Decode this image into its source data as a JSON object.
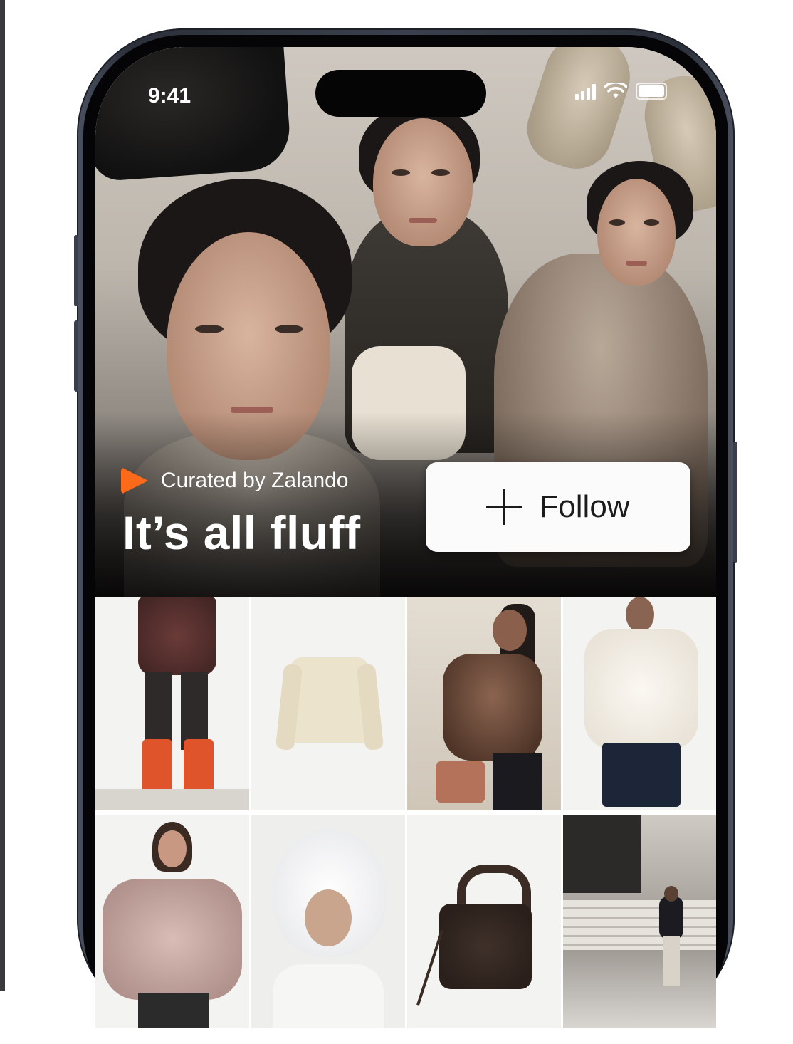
{
  "status_bar": {
    "time": "9:41",
    "icons": [
      "signal-icon",
      "wifi-icon",
      "battery-icon"
    ]
  },
  "collection": {
    "curator_label": "Curated by Zalando",
    "title": "It’s all fluff",
    "follow_label": "Follow",
    "brand_color": "#ff6a1a"
  },
  "grid": {
    "items": [
      {
        "name": "fluffy-mini-skirt"
      },
      {
        "name": "cream-faux-fur-cardigan"
      },
      {
        "name": "brown-faux-fur-jacket"
      },
      {
        "name": "white-fluffy-jacket"
      },
      {
        "name": "pink-faux-fur-jacket"
      },
      {
        "name": "white-fur-trapper-hat"
      },
      {
        "name": "brown-teddy-handbag"
      },
      {
        "name": "street-style-look"
      }
    ]
  }
}
